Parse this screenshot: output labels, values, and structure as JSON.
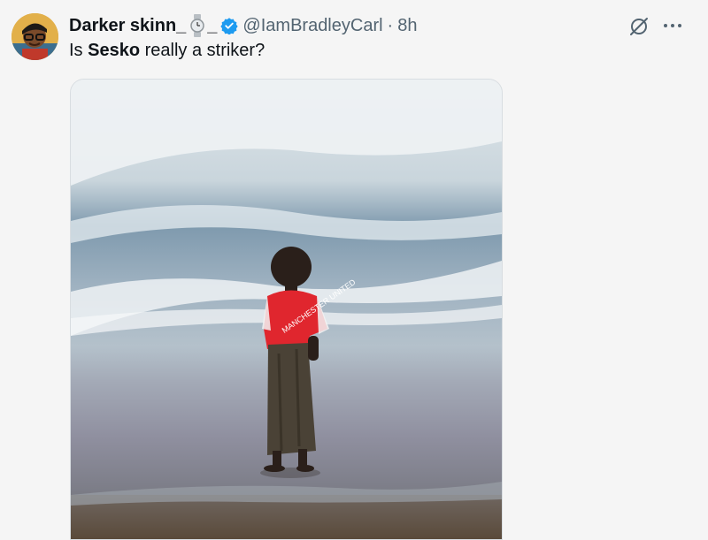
{
  "post": {
    "display_name": "Darker skinn_",
    "name_suffix": "_",
    "handle": "@IamBradleyCarl",
    "separator": "·",
    "time": "8h",
    "text_prefix": "Is ",
    "text_bold": "Sesko",
    "text_suffix": " really a striker?",
    "verified": true
  },
  "media": {
    "shirt_text": "MANCHESTER UNITED",
    "shirt_color": "#e0262e"
  },
  "icons": {
    "avatar": "avatar-image",
    "watch": "watch-emoji-icon",
    "verified": "verified-badge-icon",
    "grok": "grok-icon",
    "more": "more-options-icon"
  },
  "colors": {
    "verified_blue": "#1d9bf0",
    "secondary_text": "#536471",
    "background": "#f5f5f5"
  }
}
